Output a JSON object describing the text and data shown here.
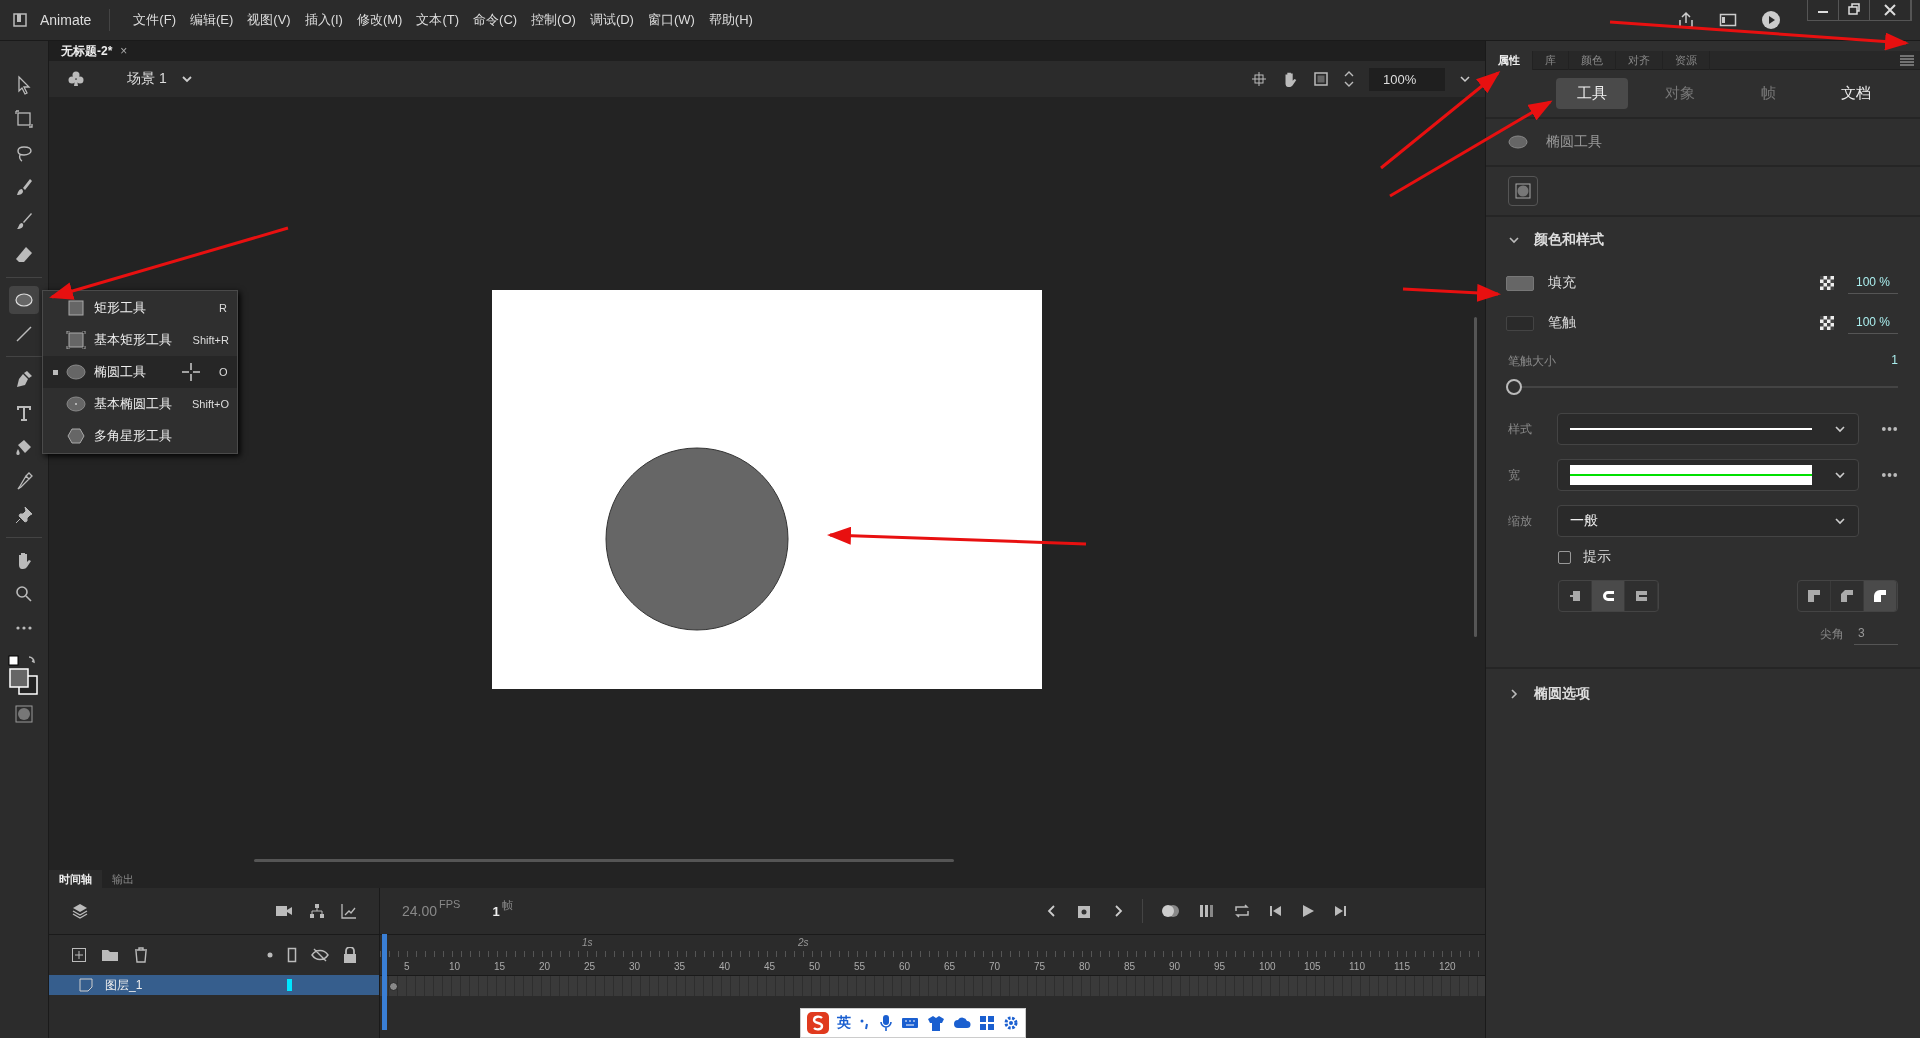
{
  "menu_bar": {
    "app": "Animate",
    "items": [
      "文件(F)",
      "编辑(E)",
      "视图(V)",
      "插入(I)",
      "修改(M)",
      "文本(T)",
      "命令(C)",
      "控制(O)",
      "调试(D)",
      "窗口(W)",
      "帮助(H)"
    ]
  },
  "document_tab": {
    "title": "无标题-2*",
    "close": "×"
  },
  "scene_bar": {
    "scene": "场景 1",
    "zoom": "100%"
  },
  "tools": [
    {
      "kind": "select",
      "selected": false
    },
    {
      "kind": "transform",
      "selected": false
    },
    {
      "kind": "lasso",
      "selected": false
    },
    {
      "kind": "paint",
      "selected": false
    },
    {
      "kind": "brush",
      "selected": false
    },
    {
      "kind": "eraser",
      "selected": false
    },
    {
      "kind": "ellipse",
      "selected": true
    },
    {
      "kind": "line",
      "selected": false
    },
    {
      "kind": "pen",
      "selected": false
    },
    {
      "kind": "text",
      "selected": false
    },
    {
      "kind": "bucket",
      "selected": false
    },
    {
      "kind": "dropper",
      "selected": false
    },
    {
      "kind": "pin",
      "selected": false
    },
    {
      "kind": "hand",
      "selected": false
    },
    {
      "kind": "zoom",
      "selected": false
    },
    {
      "kind": "more",
      "selected": false
    }
  ],
  "tool_flyout": [
    {
      "kind": "rect",
      "label": "矩形工具",
      "shortcut": "R",
      "selected": false
    },
    {
      "kind": "prim-rect",
      "label": "基本矩形工具",
      "shortcut": "Shift+R",
      "selected": false
    },
    {
      "kind": "ellipse",
      "label": "椭圆工具",
      "shortcut": "O",
      "selected": true
    },
    {
      "kind": "prim-ellipse",
      "label": "基本椭圆工具",
      "shortcut": "Shift+O",
      "selected": false
    },
    {
      "kind": "polystar",
      "label": "多角星形工具",
      "selected": false
    }
  ],
  "panel_tabs": [
    {
      "label": "属性",
      "selected": true
    },
    {
      "label": "库",
      "selected": false
    },
    {
      "label": "颜色",
      "selected": false
    },
    {
      "label": "对齐",
      "selected": false
    },
    {
      "label": "资源",
      "selected": false
    }
  ],
  "properties": {
    "subtabs": [
      {
        "label": "工具",
        "selected": true,
        "disabled": false
      },
      {
        "label": "对象",
        "selected": false,
        "disabled": true
      },
      {
        "label": "帧",
        "selected": false,
        "disabled": true
      },
      {
        "label": "文档",
        "selected": false,
        "disabled": false
      }
    ],
    "tool_name": "椭圆工具",
    "section": {
      "title": "颜色和样式",
      "expanded": true
    },
    "fill": {
      "label": "填充",
      "alpha": "100 %"
    },
    "stroke": {
      "label": "笔触",
      "alpha": "100 %"
    },
    "stroke_size": {
      "label": "笔触大小",
      "value": "1",
      "level": 0
    },
    "style_label": "样式",
    "width_label": "宽",
    "scale": {
      "label": "缩放",
      "value": "一般"
    },
    "hinting": {
      "label": "提示",
      "checked": false
    },
    "caps": [
      {
        "selected": false
      },
      {
        "selected": true
      },
      {
        "selected": false
      }
    ],
    "joins": [
      {
        "selected": false
      },
      {
        "selected": false
      },
      {
        "selected": true
      }
    ],
    "miter": {
      "label": "尖角",
      "value": "3"
    },
    "ellipse_section": {
      "title": "椭圆选项",
      "expanded": false
    }
  },
  "timeline": {
    "tabs": [
      {
        "label": "时间轴",
        "selected": true
      },
      {
        "label": "输出",
        "selected": false
      }
    ],
    "fps": "24.00",
    "fps_unit": "FPS",
    "frame": "1",
    "frame_unit": "帧",
    "seconds": [
      "1s",
      "2s"
    ],
    "ticks": [
      "5",
      "10",
      "15",
      "20",
      "25",
      "30",
      "35",
      "40",
      "45",
      "50",
      "55",
      "60",
      "65",
      "70",
      "75",
      "80",
      "85",
      "90",
      "95",
      "100",
      "105",
      "110",
      "115",
      "120"
    ],
    "layers": [
      {
        "name": "图层_1",
        "selected": true
      }
    ]
  },
  "ime_bar": {
    "mode": "英"
  }
}
